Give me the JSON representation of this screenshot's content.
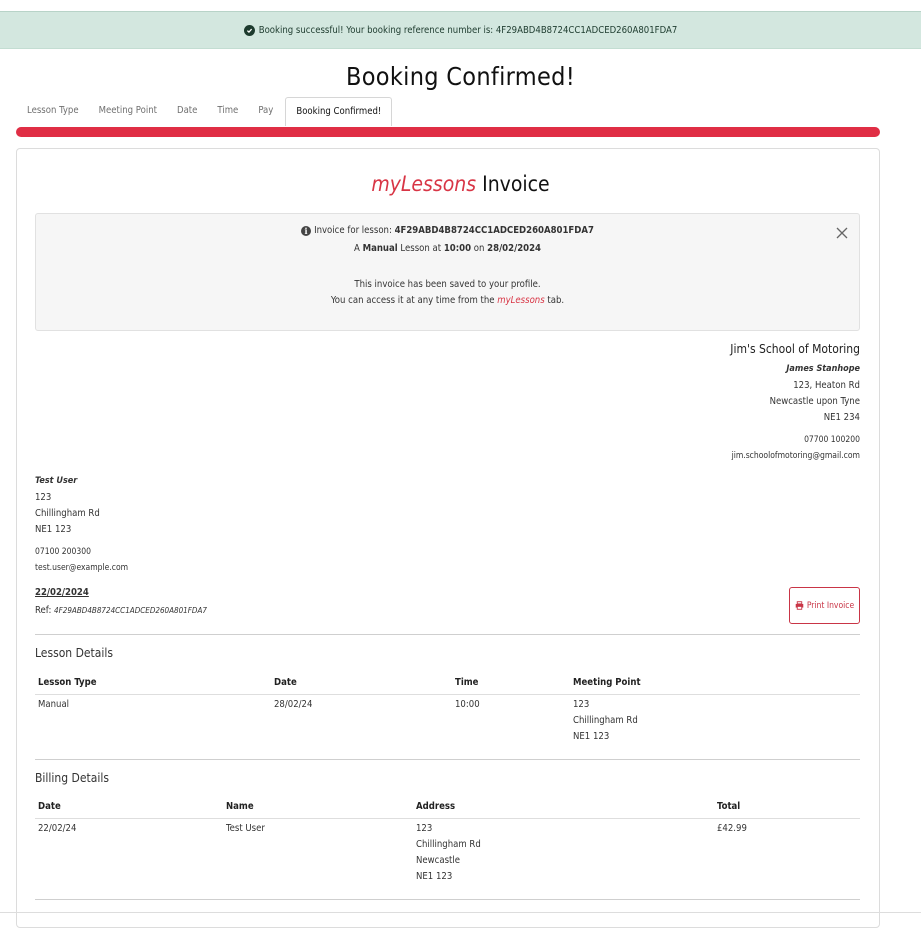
{
  "alert": {
    "message": "Booking successful! Your booking reference number is: 4F29ABD4B8724CC1ADCED260A801FDA7"
  },
  "page": {
    "title": "Booking Confirmed!"
  },
  "tabs": [
    {
      "label": "Lesson Type"
    },
    {
      "label": "Meeting Point"
    },
    {
      "label": "Date"
    },
    {
      "label": "Time"
    },
    {
      "label": "Pay"
    },
    {
      "label": "Booking Confirmed!"
    }
  ],
  "progress": {
    "percent": 100,
    "color": "#e02e45"
  },
  "invoice": {
    "brand": "myLessons",
    "title": "Invoice"
  },
  "info": {
    "prefix": "Invoice for lesson:",
    "reference": "4F29ABD4B8724CC1ADCED260A801FDA7",
    "line2_a": "A",
    "lesson_type": "Manual",
    "line2_b": "Lesson at",
    "time": "10:00",
    "line2_c": "on",
    "date": "28/02/2024",
    "saved": "This invoice has been saved to your profile.",
    "access_a": "You can access it at any time from the",
    "access_brand": "myLessons",
    "access_b": "tab."
  },
  "school": {
    "name": "Jim's School of Motoring",
    "instructor": "James Stanhope",
    "address1": "123, Heaton Rd",
    "address2": "Newcastle upon Tyne",
    "postcode": "NE1 234",
    "phone": "07700 100200",
    "email": "jim.schoolofmotoring@gmail.com"
  },
  "customer": {
    "name": "Test User",
    "address1": "123",
    "address2": "Chillingham Rd",
    "postcode": "NE1 123",
    "phone": "07100 200300",
    "email": "test.user@example.com"
  },
  "meta": {
    "date": "22/02/2024",
    "ref_label": "Ref:",
    "ref": "4F29ABD4B8724CC1ADCED260A801FDA7"
  },
  "print_label": "Print Invoice",
  "lesson_details": {
    "title": "Lesson Details",
    "headers": [
      "Lesson Type",
      "Date",
      "Time",
      "Meeting Point"
    ],
    "row": {
      "type": "Manual",
      "date": "28/02/24",
      "time": "10:00",
      "mp1": "123",
      "mp2": "Chillingham Rd",
      "mp3": "NE1 123"
    }
  },
  "billing_details": {
    "title": "Billing Details",
    "headers": [
      "Date",
      "Name",
      "Address",
      "Total"
    ],
    "row": {
      "date": "22/02/24",
      "name": "Test User",
      "a1": "123",
      "a2": "Chillingham Rd",
      "a3": "Newcastle",
      "a4": "NE1 123",
      "total": "£42.99"
    }
  }
}
